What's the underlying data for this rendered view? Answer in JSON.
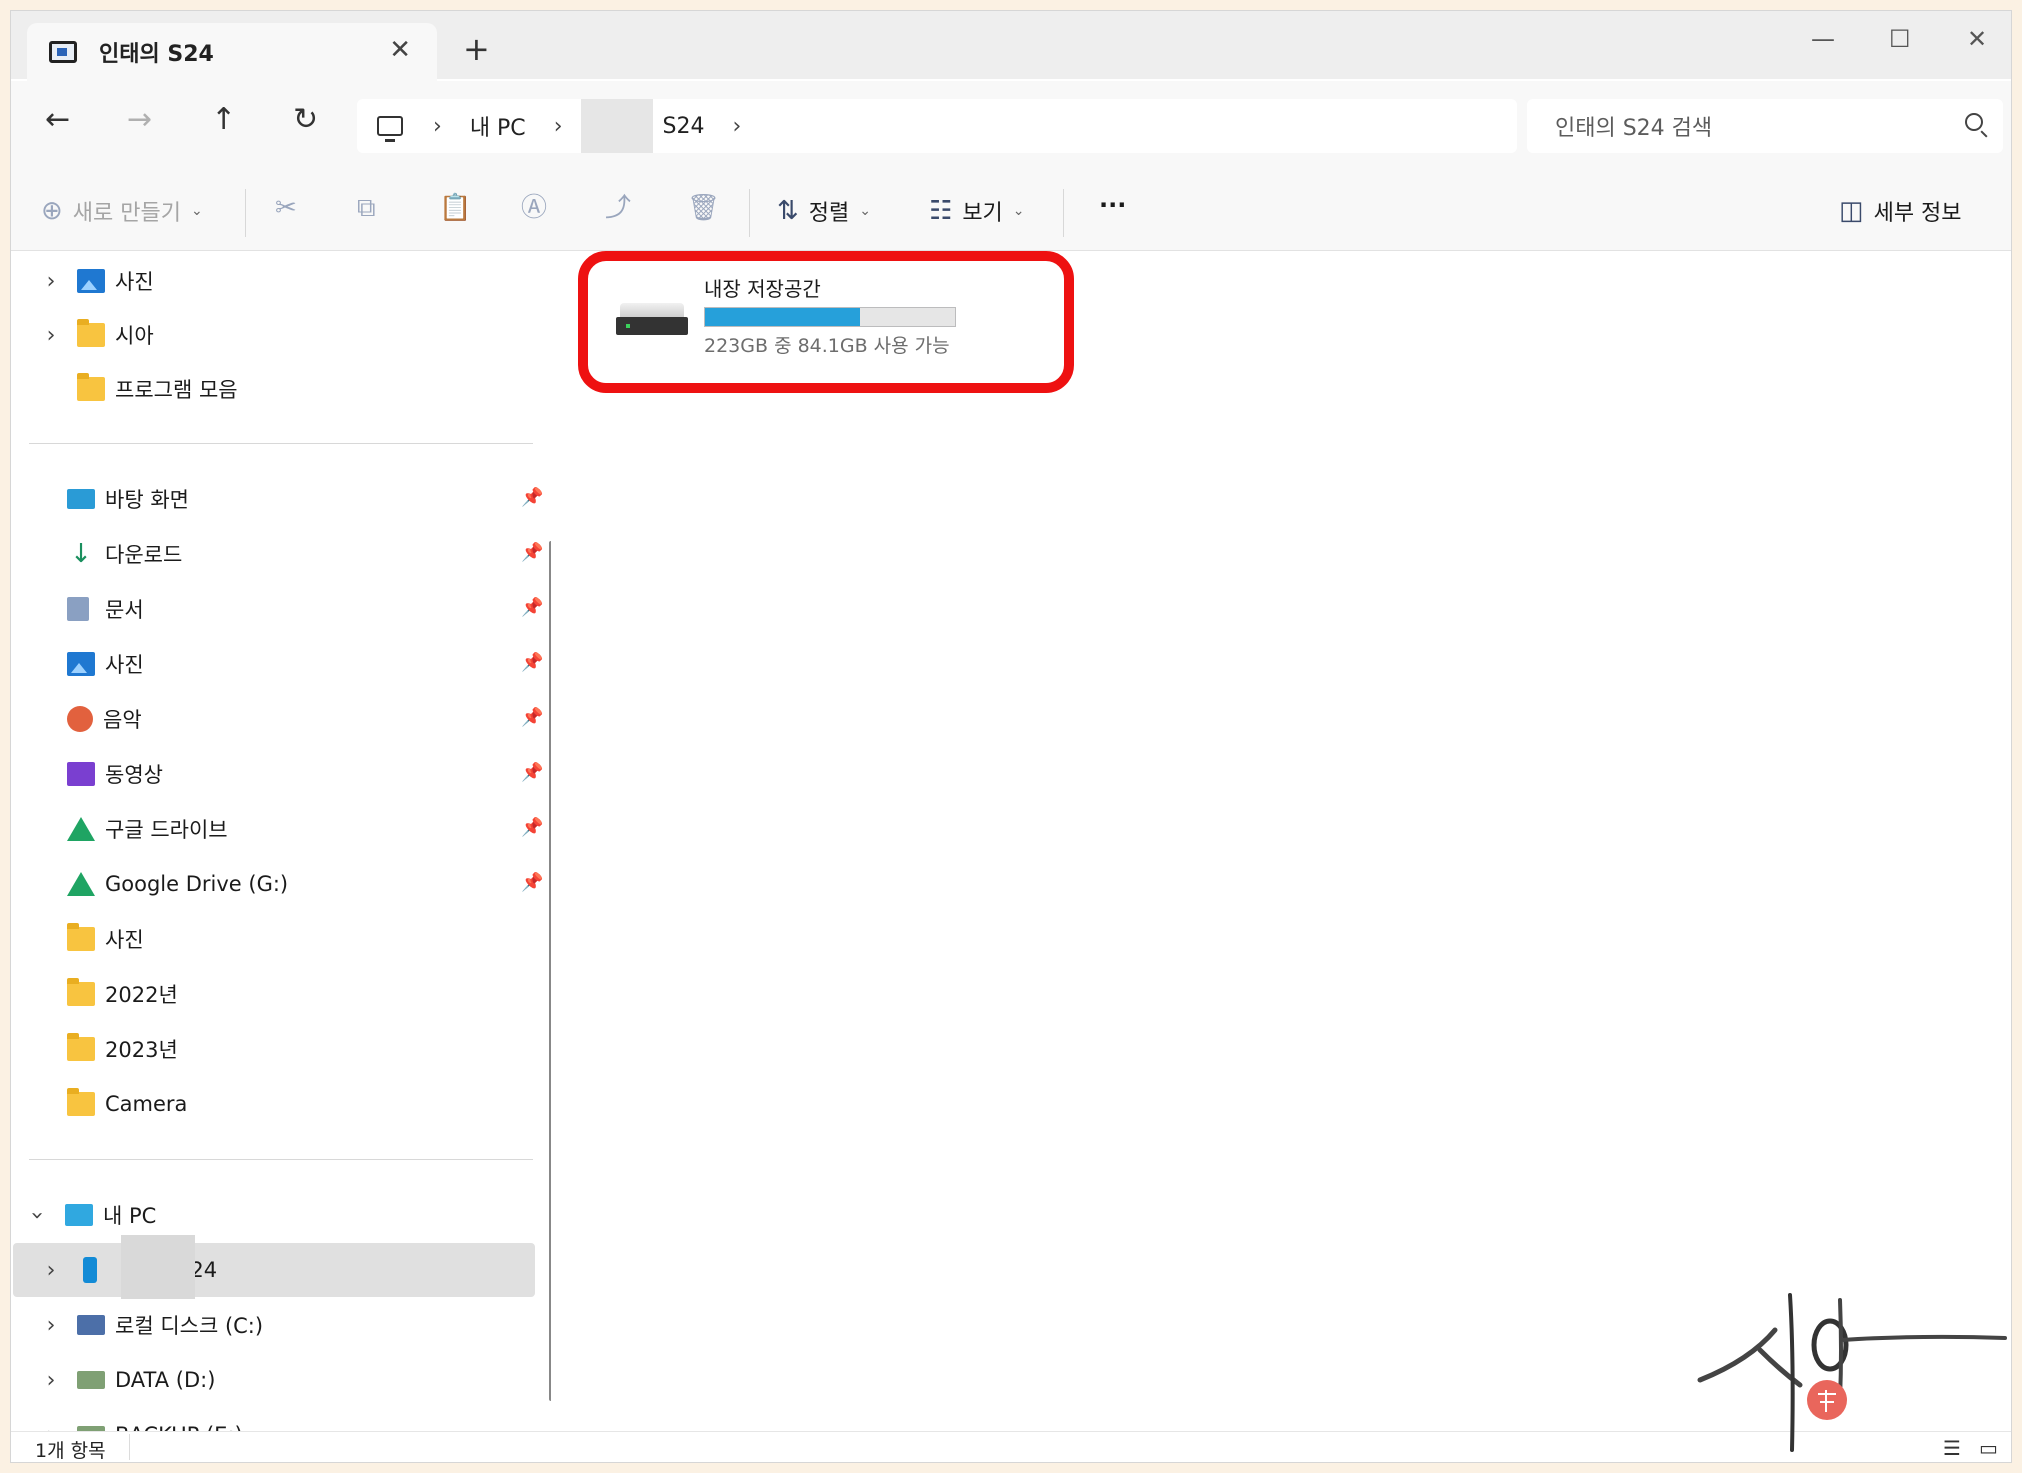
{
  "window": {
    "tab_title": "인태의 S24",
    "tab_close": "✕",
    "new_tab": "+",
    "minimize": "—",
    "maximize": "☐",
    "close": "✕"
  },
  "nav": {
    "back": "←",
    "forward": "→",
    "up": "↑",
    "refresh": "↻",
    "breadcrumb": [
      {
        "label": "내 PC"
      },
      {
        "label": "S24"
      }
    ],
    "crumb_sep": "›",
    "search_placeholder": "인태의 S24 검색"
  },
  "toolbar": {
    "new_label": "새로 만들기",
    "new_icon": "⊕",
    "sort_label": "정렬",
    "view_label": "보기",
    "more_label": "···",
    "details_label": "세부 정보",
    "caret": "⌄"
  },
  "sidebar": {
    "top_items": [
      {
        "label": "사진",
        "icon": "photo-icon"
      },
      {
        "label": "시아",
        "icon": "folder-icon"
      },
      {
        "label": "프로그램 모음",
        "icon": "folder-icon"
      }
    ],
    "quick_access": [
      {
        "label": "바탕 화면",
        "icon": "desktop-icon",
        "pinned": true
      },
      {
        "label": "다운로드",
        "icon": "download-icon",
        "pinned": true
      },
      {
        "label": "문서",
        "icon": "document-icon",
        "pinned": true
      },
      {
        "label": "사진",
        "icon": "photo-icon",
        "pinned": true
      },
      {
        "label": "음악",
        "icon": "music-icon",
        "pinned": true
      },
      {
        "label": "동영상",
        "icon": "video-icon",
        "pinned": true
      },
      {
        "label": "구글 드라이브",
        "icon": "google-drive-icon",
        "pinned": true
      },
      {
        "label": "Google Drive (G:)",
        "icon": "google-drive-icon",
        "pinned": true
      },
      {
        "label": "사진",
        "icon": "folder-icon",
        "pinned": false
      },
      {
        "label": "2022년",
        "icon": "folder-icon",
        "pinned": false
      },
      {
        "label": "2023년",
        "icon": "folder-icon",
        "pinned": false
      },
      {
        "label": "Camera",
        "icon": "folder-icon",
        "pinned": false
      }
    ],
    "pin_glyph": "📌",
    "this_pc": {
      "label": "내 PC",
      "icon": "monitor-icon"
    },
    "pc_items": [
      {
        "label": "S24",
        "icon": "phone-icon",
        "selected": true
      },
      {
        "label": "로컬 디스크 (C:)",
        "icon": "disk-icon"
      },
      {
        "label": "DATA (D:)",
        "icon": "disk-icon"
      },
      {
        "label": "BACKUP (E:)",
        "icon": "disk-icon"
      }
    ]
  },
  "content": {
    "drive": {
      "name": "내장 저장공간",
      "free_text": "223GB 중 84.1GB 사용 가능",
      "used_fraction": 0.62,
      "bar_color": "#26a0da",
      "highlight_color": "#ee1111"
    }
  },
  "status": {
    "item_count": "1개 항목",
    "list_view": "☰",
    "tile_view": "▭"
  },
  "watermark": {
    "text": "시아",
    "seal_color": "#e9665c"
  }
}
